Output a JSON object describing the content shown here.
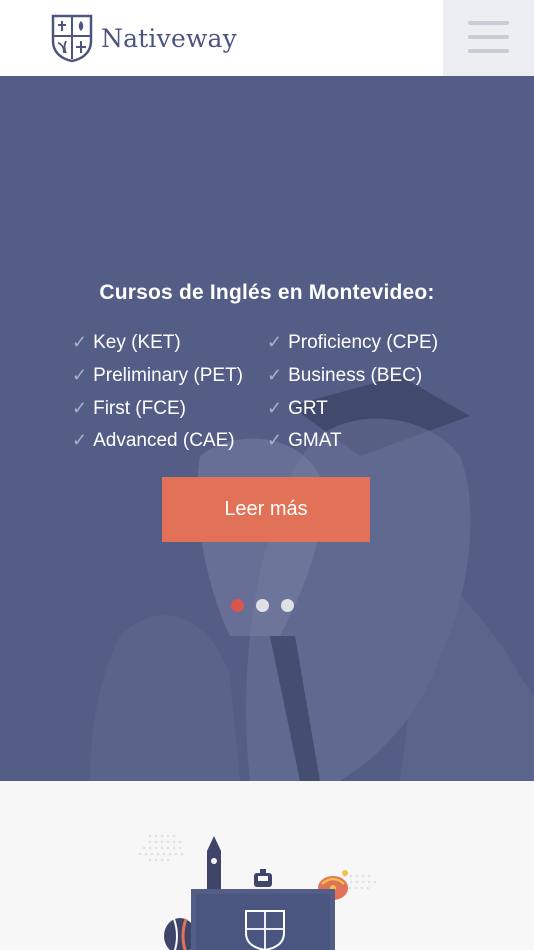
{
  "header": {
    "brand": "Nativeway",
    "menu_icon": "hamburger-menu-icon"
  },
  "hero": {
    "title": "Cursos de Inglés en Montevideo:",
    "courses_left": [
      "Key (KET)",
      "Preliminary (PET)",
      "First (FCE)",
      "Advanced (CAE)"
    ],
    "courses_right": [
      "Proficiency (CPE)",
      "Business (BEC)",
      "GRT",
      "GMAT"
    ],
    "cta_label": "Leer más",
    "slides": {
      "count": 3,
      "active": 1
    }
  },
  "colors": {
    "brand": "#4a5580",
    "hero_overlay": "#545d86",
    "cta": "#e27257",
    "active_dot": "#d9574a"
  }
}
